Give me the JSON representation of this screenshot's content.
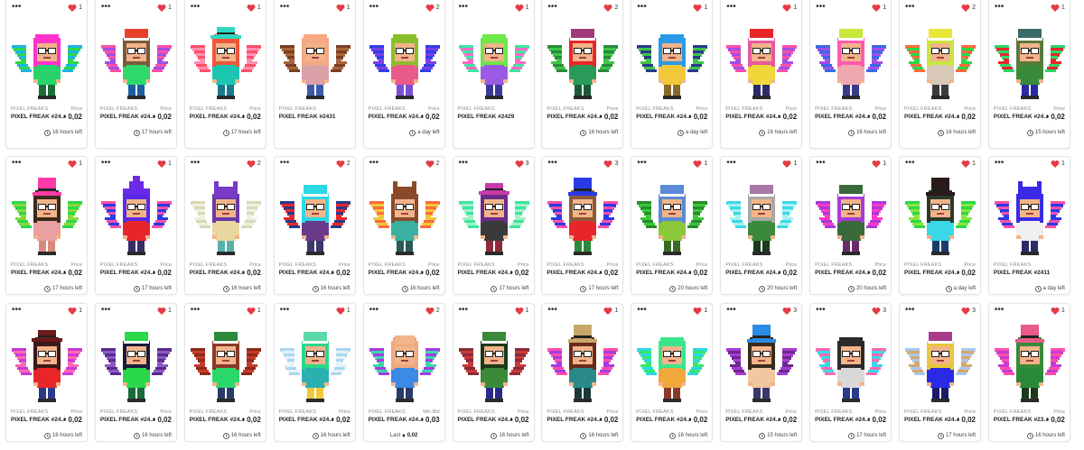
{
  "grid": {
    "more_glyph": "•••",
    "collection": "PIXEL FREAKS",
    "price_label": "Price",
    "min_bid_label": "Min Bid",
    "last_label": "Last",
    "eth_glyph": "♦",
    "heart_color": "#e63b46"
  },
  "cards": [
    {
      "favorites": "1",
      "name": "PIXEL FREAK #24...",
      "price": "0,02",
      "time": "16 hours left",
      "hair": "#ff33cc",
      "hat": "none",
      "wing1": "#1fb3e6",
      "wing2": "#2dd84a",
      "shirt": "#26d46a",
      "pants": "#1d6e36"
    },
    {
      "favorites": "1",
      "name": "PIXEL FREAK #24...",
      "price": "0,02",
      "time": "17 hours left",
      "hair": "#7a5a3a",
      "hat": "beanie",
      "hatc": "#e8402a",
      "wing1": "#ff4fa8",
      "wing2": "#a24fe6",
      "shirt": "#2fd86a",
      "pants": "#1a5fa3"
    },
    {
      "favorites": "1",
      "name": "PIXEL FREAK #24...",
      "price": "0,02",
      "time": "17 hours left",
      "hair": "#f0563a",
      "hat": "fedora",
      "hatc": "#2ed8c0",
      "wing1": "#ff4f6a",
      "wing2": "#ff8fb0",
      "shirt": "#1cc6b0",
      "pants": "#187a8a"
    },
    {
      "favorites": "1",
      "name": "PIXEL FREAK #2431",
      "price": "",
      "time": "",
      "hair": "#f5a882",
      "hat": "none",
      "wing1": "#7a3f22",
      "wing2": "#a8653a",
      "shirt": "#d9a0a8",
      "pants": "#3a5aa8"
    },
    {
      "favorites": "2",
      "name": "PIXEL FREAK #24...",
      "price": "0,02",
      "time": "a day left",
      "hair": "#8bbf2a",
      "hat": "none",
      "wing1": "#2f3fe6",
      "wing2": "#7a3fe6",
      "shirt": "#e85a8a",
      "pants": "#7a4fd6"
    },
    {
      "favorites": "1",
      "name": "PIXEL FREAK #2429",
      "price": "",
      "time": "",
      "hair": "#6ee84a",
      "hat": "none",
      "wing1": "#3fe6a0",
      "wing2": "#ff6ac8",
      "shirt": "#9a5ae6",
      "pants": "#3a3a9a"
    },
    {
      "favorites": "2",
      "name": "PIXEL FREAK #24...",
      "price": "0,02",
      "time": "16 hours left",
      "hair": "#e8262a",
      "hat": "beanie",
      "hatc": "#a03a7a",
      "wing1": "#2a8a3a",
      "wing2": "#3fc44a",
      "shirt": "#2a9a5a",
      "pants": "#1a5a3a"
    },
    {
      "favorites": "1",
      "name": "PIXEL FREAK #24...",
      "price": "0,02",
      "time": "a day left",
      "hair": "#2a9ae6",
      "hat": "none",
      "wing1": "#2a3a8a",
      "wing2": "#3fc44a",
      "shirt": "#f0c83a",
      "pants": "#8a6a2a"
    },
    {
      "favorites": "1",
      "name": "PIXEL FREAK #24...",
      "price": "0,02",
      "time": "16 hours left",
      "hair": "#e85aa0",
      "hat": "beanie",
      "hatc": "#e8262a",
      "wing1": "#ff4fa8",
      "wing2": "#a24fe6",
      "shirt": "#f0d83a",
      "pants": "#2a2a6a"
    },
    {
      "favorites": "1",
      "name": "PIXEL FREAK #24...",
      "price": "0,02",
      "time": "16 hours left",
      "hair": "#ff5ab0",
      "hat": "beanie",
      "hatc": "#c8e83a",
      "wing1": "#3a6ae6",
      "wing2": "#a24fe6",
      "shirt": "#f0a8b0",
      "pants": "#3a3a8a"
    },
    {
      "favorites": "2",
      "name": "PIXEL FREAK #24...",
      "price": "0,02",
      "time": "16 hours left",
      "hair": "#c8e83a",
      "hat": "beanie",
      "hatc": "#e8e83a",
      "wing1": "#ff6a3a",
      "wing2": "#2ad84a",
      "shirt": "#d8c8b8",
      "pants": "#3a3a3a"
    },
    {
      "favorites": "1",
      "name": "PIXEL FREAK #24...",
      "price": "0,02",
      "time": "15 hours left",
      "hair": "#5a7a3a",
      "hat": "beanie",
      "hatc": "#3a6a6a",
      "wing1": "#2ad86a",
      "wing2": "#e8262a",
      "shirt": "#3a8a3a",
      "pants": "#2a2aa0"
    },
    {
      "favorites": "1",
      "name": "PIXEL FREAK #24...",
      "price": "0,02",
      "time": "17 hours left",
      "hair": "#3a2a1a",
      "hat": "tophat",
      "hatc": "#ff3aa8",
      "wing1": "#2ad84a",
      "wing2": "#8ad83a",
      "shirt": "#e8a0a0",
      "pants": "#d88a7a"
    },
    {
      "favorites": "1",
      "name": "PIXEL FREAK #24...",
      "price": "0,02",
      "time": "17 hours left",
      "hair": "#5a2ae6",
      "hat": "wizard",
      "hatc": "#6a2ae6",
      "wing1": "#ff4fa8",
      "wing2": "#2a3ae6",
      "shirt": "#e8262a",
      "pants": "#3a2a6a"
    },
    {
      "favorites": "2",
      "name": "PIXEL FREAK #24...",
      "price": "0,02",
      "time": "16 hours left",
      "hair": "#6a3aa8",
      "hat": "bat",
      "hatc": "#7a3ac8",
      "wing1": "#d8d8b8",
      "wing2": "#f0f0e0",
      "shirt": "#e8d8a0",
      "pants": "#5ab0a8"
    },
    {
      "favorites": "2",
      "name": "PIXEL FREAK #24...",
      "price": "0,02",
      "time": "16 hours left",
      "hair": "#2ad8e6",
      "hat": "beanie",
      "hatc": "#2ad8e6",
      "wing1": "#2a3a8a",
      "wing2": "#e8262a",
      "shirt": "#6a3a8a",
      "pants": "#3a3a6a"
    },
    {
      "favorites": "2",
      "name": "PIXEL FREAK #24...",
      "price": "0,02",
      "time": "16 hours left",
      "hair": "#8a4a2a",
      "hat": "bat",
      "hatc": "#8a4a2a",
      "wing1": "#ff6a3a",
      "wing2": "#f0c83a",
      "shirt": "#3ab0a0",
      "pants": "#2a5a5a"
    },
    {
      "favorites": "3",
      "name": "PIXEL FREAK #24...",
      "price": "0,02",
      "time": "17 hours left",
      "hair": "#6a2a8a",
      "hat": "fedora",
      "hatc": "#c83aa8",
      "wing1": "#3ae6a0",
      "wing2": "#a8f0c8",
      "shirt": "#3a3a3a",
      "pants": "#8a2a3a"
    },
    {
      "favorites": "3",
      "name": "PIXEL FREAK #24...",
      "price": "0,02",
      "time": "17 hours left",
      "hair": "#8a5a3a",
      "hat": "tophat",
      "hatc": "#2a3ae6",
      "wing1": "#ff4fa8",
      "wing2": "#2a3ae6",
      "shirt": "#e8262a",
      "pants": "#2a8a3a"
    },
    {
      "favorites": "1",
      "name": "PIXEL FREAK #24...",
      "price": "0,02",
      "time": "20 hours left",
      "hair": "#5a8ad8",
      "hat": "beanie",
      "hatc": "#5a8ad8",
      "wing1": "#2a8a2a",
      "wing2": "#3ac83a",
      "shirt": "#8ac83a",
      "pants": "#3a6a2a"
    },
    {
      "favorites": "1",
      "name": "PIXEL FREAK #24...",
      "price": "0,02",
      "time": "20 hours left",
      "hair": "#a8a8a8",
      "hat": "beanie",
      "hatc": "#a878a8",
      "wing1": "#3ad8e6",
      "wing2": "#a8f0f0",
      "shirt": "#3a8a3a",
      "pants": "#1a3a1a"
    },
    {
      "favorites": "1",
      "name": "PIXEL FREAK #24...",
      "price": "0,02",
      "time": "20 hours left",
      "hair": "#a83ad8",
      "hat": "beanie",
      "hatc": "#3a6a3a",
      "wing1": "#a83ad8",
      "wing2": "#ff3ac8",
      "shirt": "#3a6a3a",
      "pants": "#6a2a6a"
    },
    {
      "favorites": "1",
      "name": "PIXEL FREAK #24...",
      "price": "0,02",
      "time": "a day left",
      "hair": "#2a3a2a",
      "hat": "tophat",
      "hatc": "#2a1a1a",
      "wing1": "#2ad84a",
      "wing2": "#8ae63a",
      "shirt": "#3ad8e6",
      "pants": "#1a3a6a"
    },
    {
      "favorites": "1",
      "name": "PIXEL FREAK #2411",
      "price": "",
      "time": "a day left",
      "hair": "#3a2ae6",
      "hat": "bat",
      "hatc": "#3a2ae6",
      "wing1": "#ff4fa8",
      "wing2": "#2a3ae6",
      "shirt": "#f0f0f0",
      "pants": "#2a2a6a"
    },
    {
      "favorites": "1",
      "name": "PIXEL FREAK #24...",
      "price": "0,02",
      "time": "16 hours left",
      "hair": "#3a1a1a",
      "hat": "fedora",
      "hatc": "#6a1a1a",
      "wing1": "#c83ad8",
      "wing2": "#ff6ab0",
      "shirt": "#e8262a",
      "pants": "#2a3a8a"
    },
    {
      "favorites": "1",
      "name": "PIXEL FREAK #24...",
      "price": "0,02",
      "time": "16 hours left",
      "hair": "#1a1a3a",
      "hat": "beanie",
      "hatc": "#2ad84a",
      "wing1": "#5a2a8a",
      "wing2": "#8a5ac8",
      "shirt": "#2ad84a",
      "pants": "#1a6a3a"
    },
    {
      "favorites": "1",
      "name": "PIXEL FREAK #24...",
      "price": "0,02",
      "time": "16 hours left",
      "hair": "#8a3a2a",
      "hat": "beanie",
      "hatc": "#2a8a3a",
      "wing1": "#8a2a1a",
      "wing2": "#c83a2a",
      "shirt": "#2ad86a",
      "pants": "#2a3a6a"
    },
    {
      "favorites": "1",
      "name": "PIXEL FREAK #24...",
      "price": "0,02",
      "time": "16 hours left",
      "hair": "#2ad88a",
      "hat": "beanie",
      "hatc": "#5ad8a8",
      "wing1": "#a8d8f0",
      "wing2": "#e8f0f8",
      "shirt": "#2ab0b0",
      "pants": "#f0c83a"
    },
    {
      "favorites": "2",
      "name": "PIXEL FREAK #24...",
      "price": "0,03",
      "min_bid": "yes",
      "last": "0,02",
      "hair": "#f0a880",
      "hat": "bald",
      "wing1": "#a83ae6",
      "wing2": "#3ad8a8",
      "shirt": "#3a8ae6",
      "pants": "#2a3a6a"
    },
    {
      "favorites": "1",
      "name": "PIXEL FREAK #24...",
      "price": "0,02",
      "time": "16 hours left",
      "hair": "#1a3a1a",
      "hat": "beanie",
      "hatc": "#3a8a3a",
      "wing1": "#8a2a3a",
      "wing2": "#c83a3a",
      "shirt": "#3a8a3a",
      "pants": "#2a2a8a"
    },
    {
      "favorites": "1",
      "name": "PIXEL FREAK #24...",
      "price": "0,02",
      "time": "16 hours left",
      "hair": "#6a2a1a",
      "hat": "tophat",
      "hatc": "#c8a86a",
      "wing1": "#ff4fa8",
      "wing2": "#a83ae6",
      "shirt": "#2a8a8a",
      "pants": "#1a3a3a"
    },
    {
      "favorites": "1",
      "name": "PIXEL FREAK #24...",
      "price": "0,02",
      "time": "16 hours left",
      "hair": "#3ae68a",
      "hat": "none",
      "wing1": "#2ad8e6",
      "wing2": "#3ae66a",
      "shirt": "#f0a83a",
      "pants": "#8a3a2a"
    },
    {
      "favorites": "3",
      "name": "PIXEL FREAK #24...",
      "price": "0,02",
      "time": "15 hours left",
      "hair": "#3a2a1a",
      "hat": "tophat",
      "hatc": "#2a8ae6",
      "wing1": "#a83ad8",
      "wing2": "#6a2a8a",
      "shirt": "#f0c8a0",
      "pants": "#3a3a6a"
    },
    {
      "favorites": "3",
      "name": "PIXEL FREAK #24...",
      "price": "0,02",
      "time": "17 hours left",
      "hair": "#2a2a2a",
      "hat": "none",
      "wing1": "#ff6ab0",
      "wing2": "#3ad8e6",
      "shirt": "#d8d8d8",
      "pants": "#2a3a8a"
    },
    {
      "favorites": "3",
      "name": "PIXEL FREAK #24...",
      "price": "0,02",
      "time": "17 hours left",
      "hair": "#e8c83a",
      "hat": "beanie",
      "hatc": "#a83a8a",
      "wing1": "#a8c8f0",
      "wing2": "#d8a86a",
      "shirt": "#2a2ae6",
      "pants": "#1a1a6a"
    },
    {
      "favorites": "1",
      "name": "PIXEL FREAK #23...",
      "price": "0,02",
      "time": "16 hours left",
      "hair": "#3a8a3a",
      "hat": "tophat",
      "hatc": "#e85a8a",
      "wing1": "#ff4fa8",
      "wing2": "#c83ad8",
      "shirt": "#2a8a3a",
      "pants": "#1a3a1a"
    }
  ]
}
